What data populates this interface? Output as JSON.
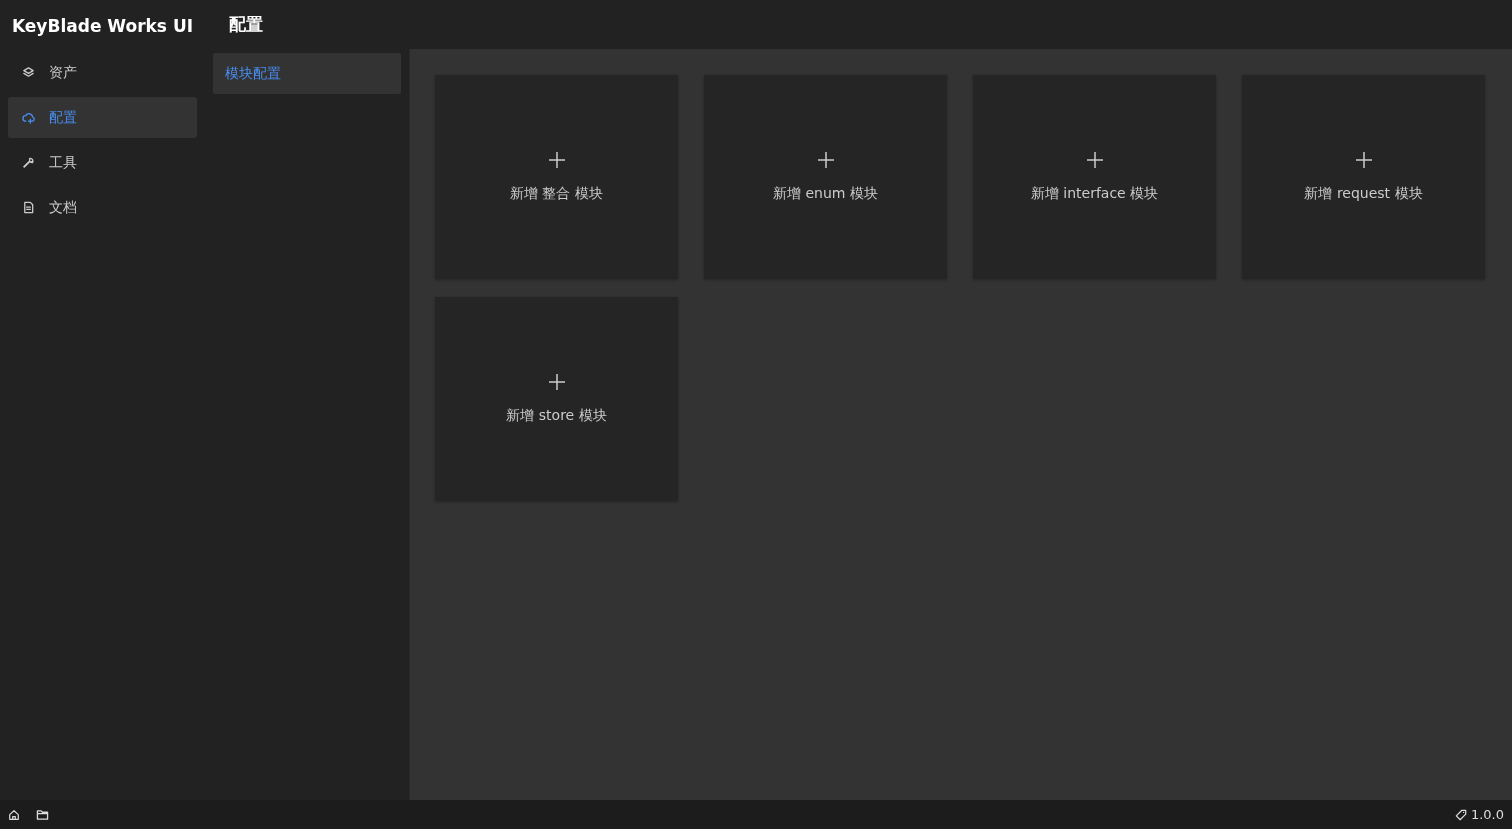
{
  "app": {
    "title": "KeyBlade Works UI"
  },
  "sidebar": {
    "items": [
      {
        "label": "资产",
        "selected": false
      },
      {
        "label": "配置",
        "selected": true
      },
      {
        "label": "工具",
        "selected": false
      },
      {
        "label": "文档",
        "selected": false
      }
    ]
  },
  "header": {
    "title": "配置"
  },
  "subnav": {
    "items": [
      {
        "label": "模块配置",
        "selected": true
      }
    ]
  },
  "cards": [
    {
      "label": "新增 整合 模块"
    },
    {
      "label": "新增 enum 模块"
    },
    {
      "label": "新增 interface 模块"
    },
    {
      "label": "新增 request 模块"
    },
    {
      "label": "新增 store 模块"
    }
  ],
  "status_bar": {
    "version": "1.0.0"
  }
}
